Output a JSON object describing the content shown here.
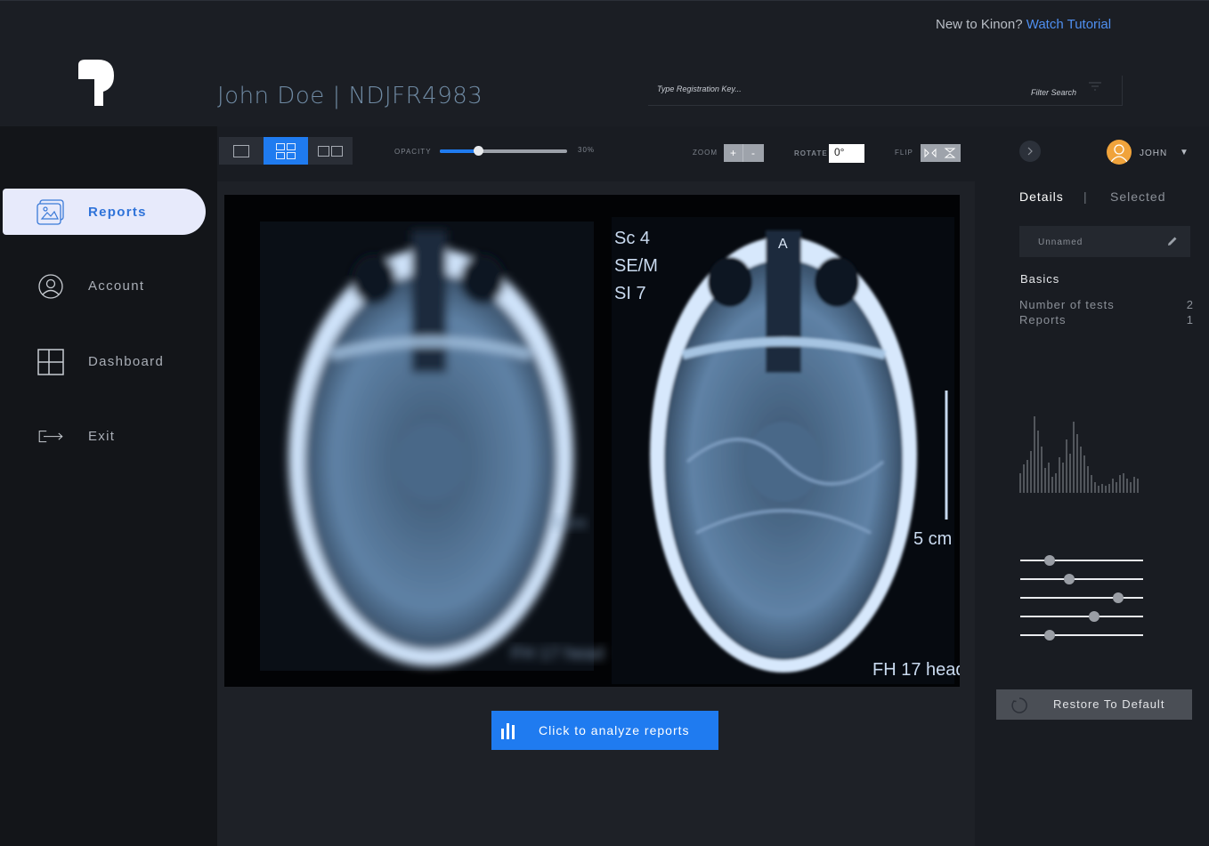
{
  "header": {
    "tutorial_prefix": "New to Kinon?",
    "tutorial_link": "Watch Tutorial",
    "patient_title": "John Doe | NDJFR4983",
    "search_placeholder": "Type Registration Key...",
    "filter_label": "Filter Search"
  },
  "sidebar": {
    "items": [
      {
        "label": "Reports",
        "icon": "reports-icon",
        "active": true
      },
      {
        "label": "Account",
        "icon": "account-icon",
        "active": false
      },
      {
        "label": "Dashboard",
        "icon": "dashboard-icon",
        "active": false
      },
      {
        "label": "Exit",
        "icon": "exit-icon",
        "active": false
      }
    ]
  },
  "toolbar": {
    "opacity_label": "OPACITY",
    "opacity_value": "30%",
    "opacity_fraction": 0.3,
    "zoom_label": "ZOOM",
    "zoom_in": "+",
    "zoom_out": "-",
    "rotate_label": "ROTATE",
    "rotate_value": "0°",
    "flip_label": "FLIP",
    "selected_layout": "grid"
  },
  "viewer": {
    "left_scan_labels": [
      "5 cm",
      "FH 17 head"
    ],
    "right_scan_labels": [
      "Sc 4",
      "SE/M",
      "SI 7",
      "A",
      "5 cm",
      "FH 17 head"
    ],
    "analyze_button": "Click to analyze reports"
  },
  "right_panel": {
    "user_name": "JOHN",
    "tab_details": "Details",
    "tab_separator": "|",
    "tab_selected": "Selected",
    "name_value": "Unnamed",
    "basics_title": "Basics",
    "stats": [
      {
        "label": "Number of tests",
        "value": "2"
      },
      {
        "label": "Reports",
        "value": "1"
      }
    ],
    "slider_levels": [
      0.24,
      0.4,
      0.8,
      0.6,
      0.24
    ],
    "restore_button": "Restore To Default"
  },
  "colors": {
    "accent": "#1f7bf0",
    "background": "#191c22",
    "sidebar": "#131519",
    "avatar": "#f0a33b"
  }
}
